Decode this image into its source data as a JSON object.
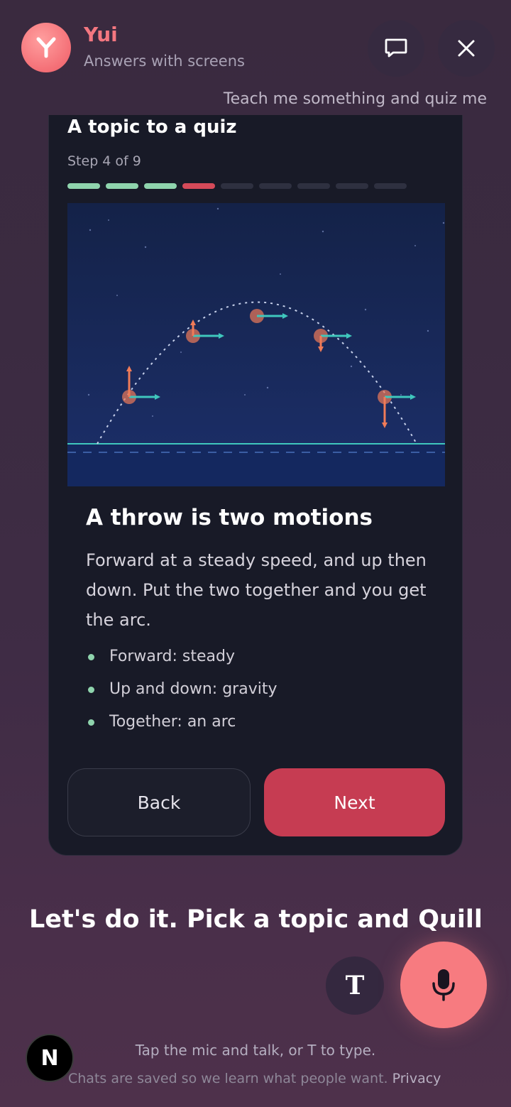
{
  "header": {
    "app_name": "Yui",
    "app_subtitle": "Answers with screens"
  },
  "user_message": "Teach me something and quiz me",
  "card": {
    "title": "A topic to a quiz",
    "step_text": "Step 4 of 9",
    "progress": {
      "current_step": 4,
      "total_steps": 9,
      "colors": {
        "done": "#8fd4ad",
        "current": "#d54a59",
        "todo": "#2e3040"
      }
    },
    "slide_title": "A throw is two motions",
    "slide_body": "Forward at a steady speed, and up then down. Put the two together and you get the arc.",
    "bullets": [
      "Forward: steady",
      "Up and down: gravity",
      "Together: an arc"
    ],
    "back_label": "Back",
    "next_label": "Next"
  },
  "assistant_reply": "Let's do it. Pick a topic and Quill",
  "composer": {
    "type_label": "T",
    "hint": "Tap the mic and talk, or T to type."
  },
  "footer": {
    "text": "Chats are saved so we learn what people want.",
    "privacy_link": "Privacy",
    "badge_letter": "N"
  },
  "colors": {
    "accent": "#f77b80",
    "next_button": "#c63c52",
    "card_bg": "#181a27"
  }
}
